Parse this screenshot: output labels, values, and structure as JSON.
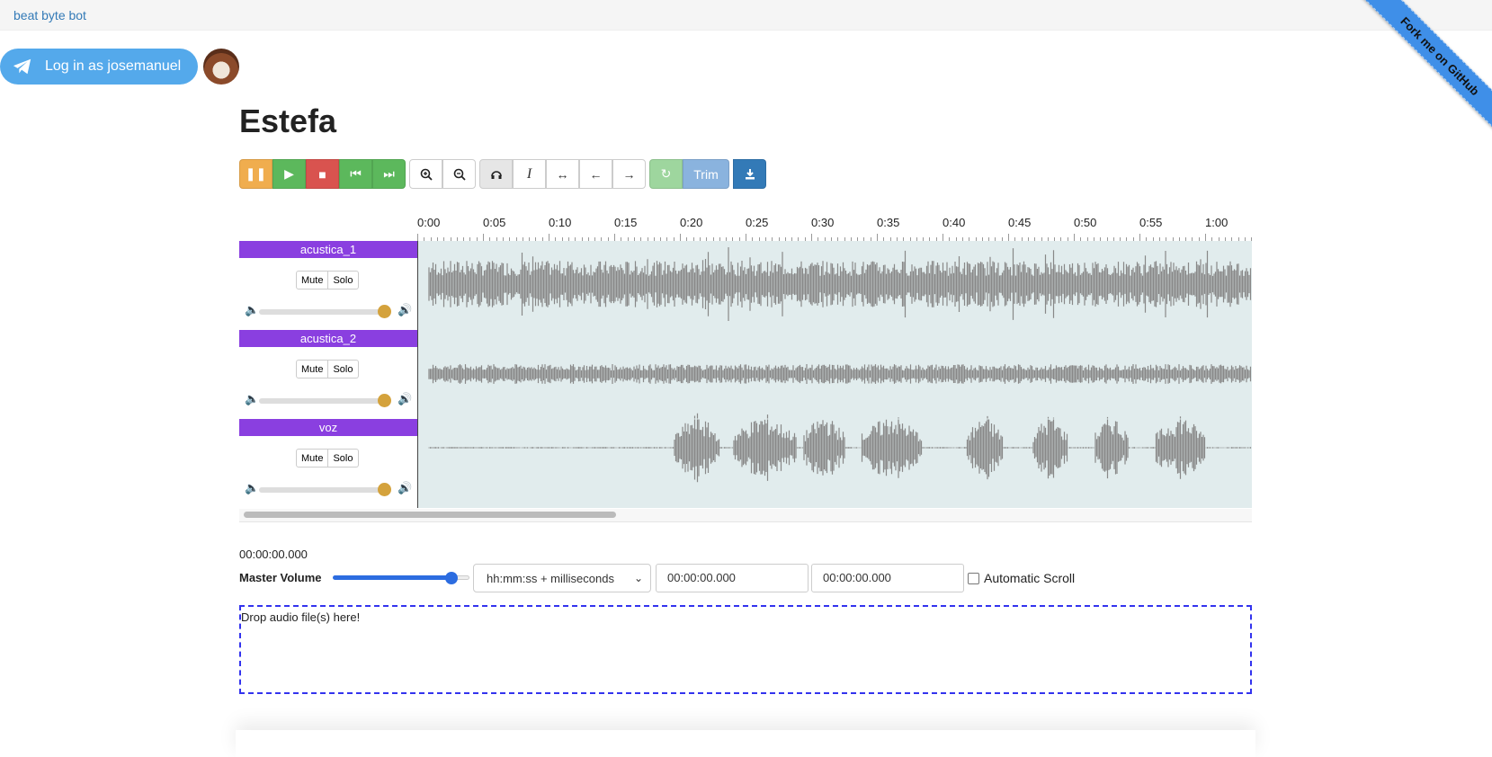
{
  "nav": {
    "brand": "beat byte bot",
    "ribbon": "Fork me on GitHub"
  },
  "login": {
    "label": "Log in as josemanuel"
  },
  "title": "Estefa",
  "toolbar": {
    "trim_label": "Trim",
    "icons": [
      "pause-icon",
      "play-icon",
      "stop-icon",
      "rewind-icon",
      "fast-forward-icon",
      "zoom-in-icon",
      "zoom-out-icon",
      "headphones-icon",
      "cursor-icon",
      "select-icon",
      "shift-left-icon",
      "shift-right-icon",
      "refresh-icon",
      "download-icon"
    ]
  },
  "timeline": {
    "labels": [
      "0:00",
      "0:05",
      "0:10",
      "0:15",
      "0:20",
      "0:25",
      "0:30",
      "0:35",
      "0:40",
      "0:45",
      "0:50",
      "0:55",
      "1:00"
    ]
  },
  "tracks": [
    {
      "name": "acustica_1",
      "mute": "Mute",
      "solo": "Solo",
      "volume": 0.92
    },
    {
      "name": "acustica_2",
      "mute": "Mute",
      "solo": "Solo",
      "volume": 0.92
    },
    {
      "name": "voz",
      "mute": "Mute",
      "solo": "Solo",
      "volume": 0.92
    }
  ],
  "colors": {
    "track_label": "#8a3fe0",
    "wave_bg": "#e1eced",
    "wave": "#888888",
    "knob": "#d4a23c"
  },
  "player": {
    "current_time": "00:00:00.000",
    "master_volume_label": "Master Volume",
    "master_volume": 0.86,
    "format": "hh:mm:ss + milliseconds",
    "start": "00:00:00.000",
    "end": "00:00:00.000",
    "auto_scroll_label": "Automatic Scroll",
    "drop_text": "Drop audio file(s) here!"
  }
}
